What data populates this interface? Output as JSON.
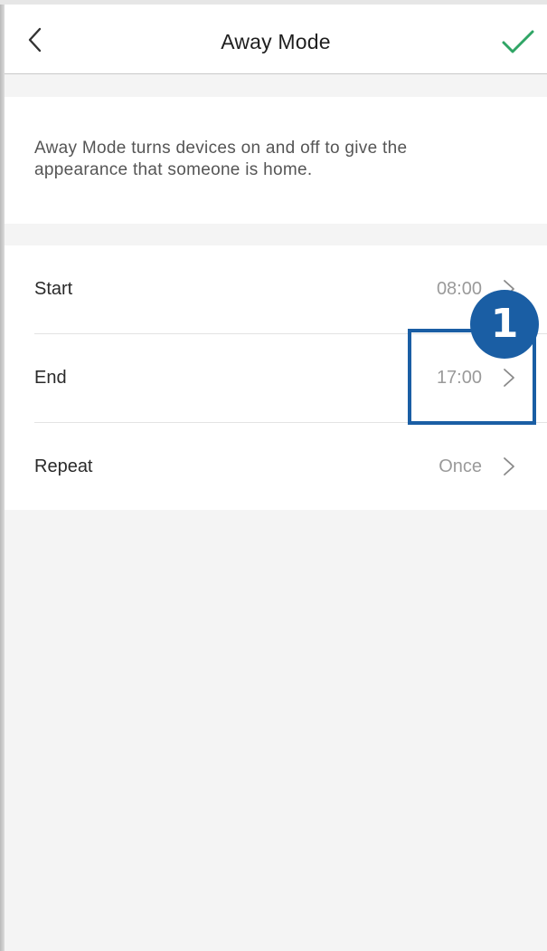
{
  "header": {
    "title": "Away Mode",
    "back_icon": "chevron-left-icon",
    "confirm_icon": "checkmark-icon",
    "accent_color": "#2fa565"
  },
  "description": {
    "text": "Away Mode turns devices on and off to give the appearance that someone is home."
  },
  "settings": {
    "rows": [
      {
        "label": "Start",
        "value": "08:00"
      },
      {
        "label": "End",
        "value": "17:00"
      },
      {
        "label": "Repeat",
        "value": "Once"
      }
    ]
  },
  "annotation": {
    "badge_number": "1",
    "color": "#1a5ea4"
  }
}
